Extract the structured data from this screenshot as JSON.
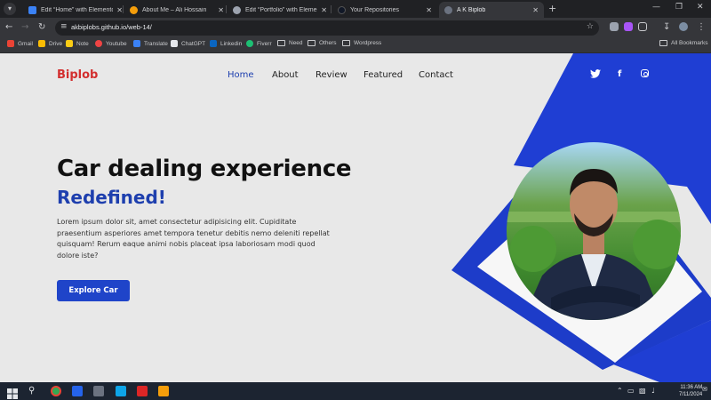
{
  "tabs": [
    {
      "title": "Edit “Home” with Elementor",
      "icon": "wordpress-icon",
      "color": "#3b82f6",
      "active": false
    },
    {
      "title": "About Me – Ali Hossain",
      "icon": "site-icon",
      "color": "#f59e0b",
      "active": false
    },
    {
      "title": "Edit “Portfolio” with Elementor",
      "icon": "globe-icon",
      "color": "#9ca3af",
      "active": false
    },
    {
      "title": "Your Repositories",
      "icon": "github-icon",
      "color": "#111827",
      "active": false
    },
    {
      "title": "A K Biplob",
      "icon": "site-icon",
      "color": "#6b7280",
      "active": true
    }
  ],
  "browser": {
    "url": "akbiplobs.github.io/web-14/"
  },
  "bookmarks": [
    {
      "label": "Gmail",
      "icon": "gmail-icon",
      "color": "#ea4335"
    },
    {
      "label": "Drive",
      "icon": "drive-icon",
      "color": "#fbbc04"
    },
    {
      "label": "Note",
      "icon": "note-icon",
      "color": "#facc15"
    },
    {
      "label": "Youtube",
      "icon": "youtube-icon",
      "color": "#ef4444"
    },
    {
      "label": "Translate",
      "icon": "translate-icon",
      "color": "#3b82f6"
    },
    {
      "label": "ChatGPT",
      "icon": "chatgpt-icon",
      "color": "#e5e7eb"
    },
    {
      "label": "Linkedin",
      "icon": "linkedin-icon",
      "color": "#0a66c2"
    },
    {
      "label": "Fiverr",
      "icon": "fiverr-icon",
      "color": "#1dbf73"
    },
    {
      "label": "Need",
      "icon": "folder-icon"
    },
    {
      "label": "Others",
      "icon": "folder-icon"
    },
    {
      "label": "Wordpress",
      "icon": "folder-icon"
    }
  ],
  "all_bookmarks": "All Bookmarks",
  "site": {
    "logo": "Biplob",
    "nav": [
      "Home",
      "About",
      "Review",
      "Featured",
      "Contact"
    ],
    "active_nav": "Home",
    "social": [
      "twitter-icon",
      "facebook-icon",
      "instagram-icon"
    ],
    "hero": {
      "title": "Car dealing experience",
      "subtitle": "Redefined!",
      "description": "Lorem ipsum dolor sit, amet consectetur adipisicing elit. Cupiditate praesentium asperiores amet tempora tenetur debitis nemo deleniti repellat quisquam! Rerum eaque animi nobis placeat ipsa laboriosam modi quod dolore iste?",
      "cta": "Explore Car"
    },
    "colors": {
      "brand": "#1f44c9",
      "logo": "#d32f2f",
      "background": "#e8e8e8"
    }
  },
  "taskbar": {
    "time": "11:36 AM",
    "date": "7/11/2024"
  }
}
